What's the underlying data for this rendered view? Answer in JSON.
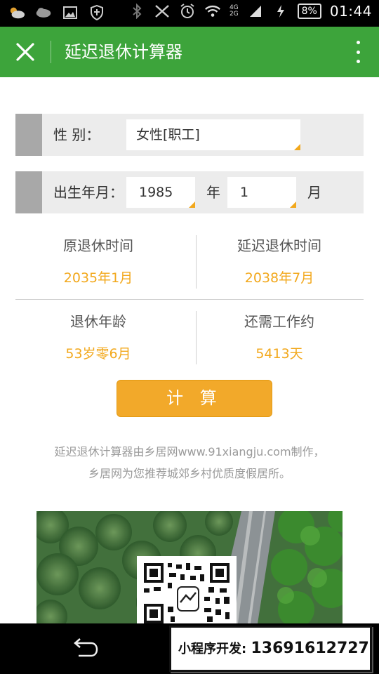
{
  "status_bar": {
    "network": [
      "4G",
      "2G"
    ],
    "battery": "8%",
    "time": "01:44"
  },
  "app_bar": {
    "title": "延迟退休计算器"
  },
  "form": {
    "gender": {
      "label": "性 别：",
      "value": "女性[职工]"
    },
    "birth": {
      "label": "出生年月：",
      "year_value": "1985",
      "year_unit": "年",
      "month_value": "1",
      "month_unit": "月"
    }
  },
  "results": {
    "original_retirement": {
      "label": "原退休时间",
      "value": "2035年1月"
    },
    "delayed_retirement": {
      "label": "延迟退休时间",
      "value": "2038年7月"
    },
    "retirement_age": {
      "label": "退休年龄",
      "value": "53岁零6月"
    },
    "remaining_work": {
      "label": "还需工作约",
      "value": "5413天"
    }
  },
  "calculate_button": "计 算",
  "credit": {
    "line1": "延迟退休计算器由乡居网www.91xiangju.com制作，",
    "line2": "乡居网为您推荐城郊乡村优质度假居所。"
  },
  "promo": {
    "label": "小程序开发:",
    "phone": "13691612727"
  },
  "colors": {
    "app_bar": "#3da43b",
    "accent": "#f2a81c",
    "row_bg": "#ececec",
    "stripe": "#a8a8a8"
  },
  "icons": [
    "weather-icon",
    "cloud-icon",
    "image-icon",
    "shield-icon",
    "bluetooth-icon",
    "vibrate-off-icon",
    "alarm-icon",
    "wifi-icon",
    "signal-icon",
    "charging-icon",
    "close-icon",
    "more-vert-icon",
    "back-icon"
  ]
}
